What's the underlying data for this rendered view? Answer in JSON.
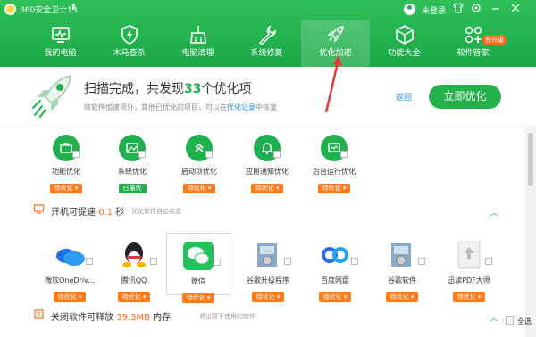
{
  "titlebar": {
    "app_title": "360安全卫士13",
    "login_label": "未登录"
  },
  "nav": {
    "items": [
      {
        "label": "我的电脑",
        "icon": "monitor-icon"
      },
      {
        "label": "木马查杀",
        "icon": "shield-bolt-icon"
      },
      {
        "label": "电脑清理",
        "icon": "broom-icon"
      },
      {
        "label": "系统修复",
        "icon": "wrench-icon"
      },
      {
        "label": "优化加速",
        "icon": "rocket-icon",
        "active": true
      },
      {
        "label": "功能大全",
        "icon": "cube-icon"
      },
      {
        "label": "软件管家",
        "icon": "apps-icon",
        "badge": "有升级"
      }
    ]
  },
  "banner": {
    "title_prefix": "扫描完成，共发现",
    "count": "33",
    "title_suffix": "个优化项",
    "sub_prefix": "除软件加速项外，其他已优化的项目，可以在",
    "sub_link": "优化记录",
    "sub_suffix": "中恢复",
    "back": "返回",
    "optimize": "立即优化"
  },
  "categories": [
    {
      "label": "功能优化",
      "status": "待优化",
      "icon": "briefcase-icon"
    },
    {
      "label": "系统优化",
      "status": "已最优",
      "icon": "image-icon"
    },
    {
      "label": "启动项优化",
      "status": "待优化",
      "icon": "chevrons-up-icon"
    },
    {
      "label": "应用通知优化",
      "status": "待优化",
      "icon": "bell-icon"
    },
    {
      "label": "后台运行优化",
      "status": "待优化",
      "icon": "screen-icon"
    }
  ],
  "boot_section": {
    "title": "开机可提速",
    "value": "0.1",
    "unit": "秒",
    "sub": "优化软件自启状态"
  },
  "apps": [
    {
      "label": "微软OneDriv...",
      "status": "待优化",
      "icon": "onedrive-icon"
    },
    {
      "label": "腾讯QQ",
      "status": "待优化",
      "icon": "qq-icon"
    },
    {
      "label": "微信",
      "status": "待优化",
      "icon": "wechat-icon"
    },
    {
      "label": "谷歌升级程序",
      "status": "待优化",
      "icon": "installer-icon"
    },
    {
      "label": "百度网盘",
      "status": "待优化",
      "icon": "baidu-netdisk-icon"
    },
    {
      "label": "谷歌软件",
      "status": "待优化",
      "icon": "installer2-icon"
    },
    {
      "label": "迅读PDF大师",
      "status": "待优化",
      "icon": "upload-doc-icon"
    }
  ],
  "release_section": {
    "title": "关闭软件可释放",
    "value": "39.3MB",
    "unit": "内存",
    "sub": "退出暂不使用的软件"
  },
  "footer": {
    "select_all": "全选"
  },
  "colors": {
    "brand_green": "#21b04f",
    "accent_orange": "#ff7a19",
    "link_blue": "#1e88e5"
  }
}
